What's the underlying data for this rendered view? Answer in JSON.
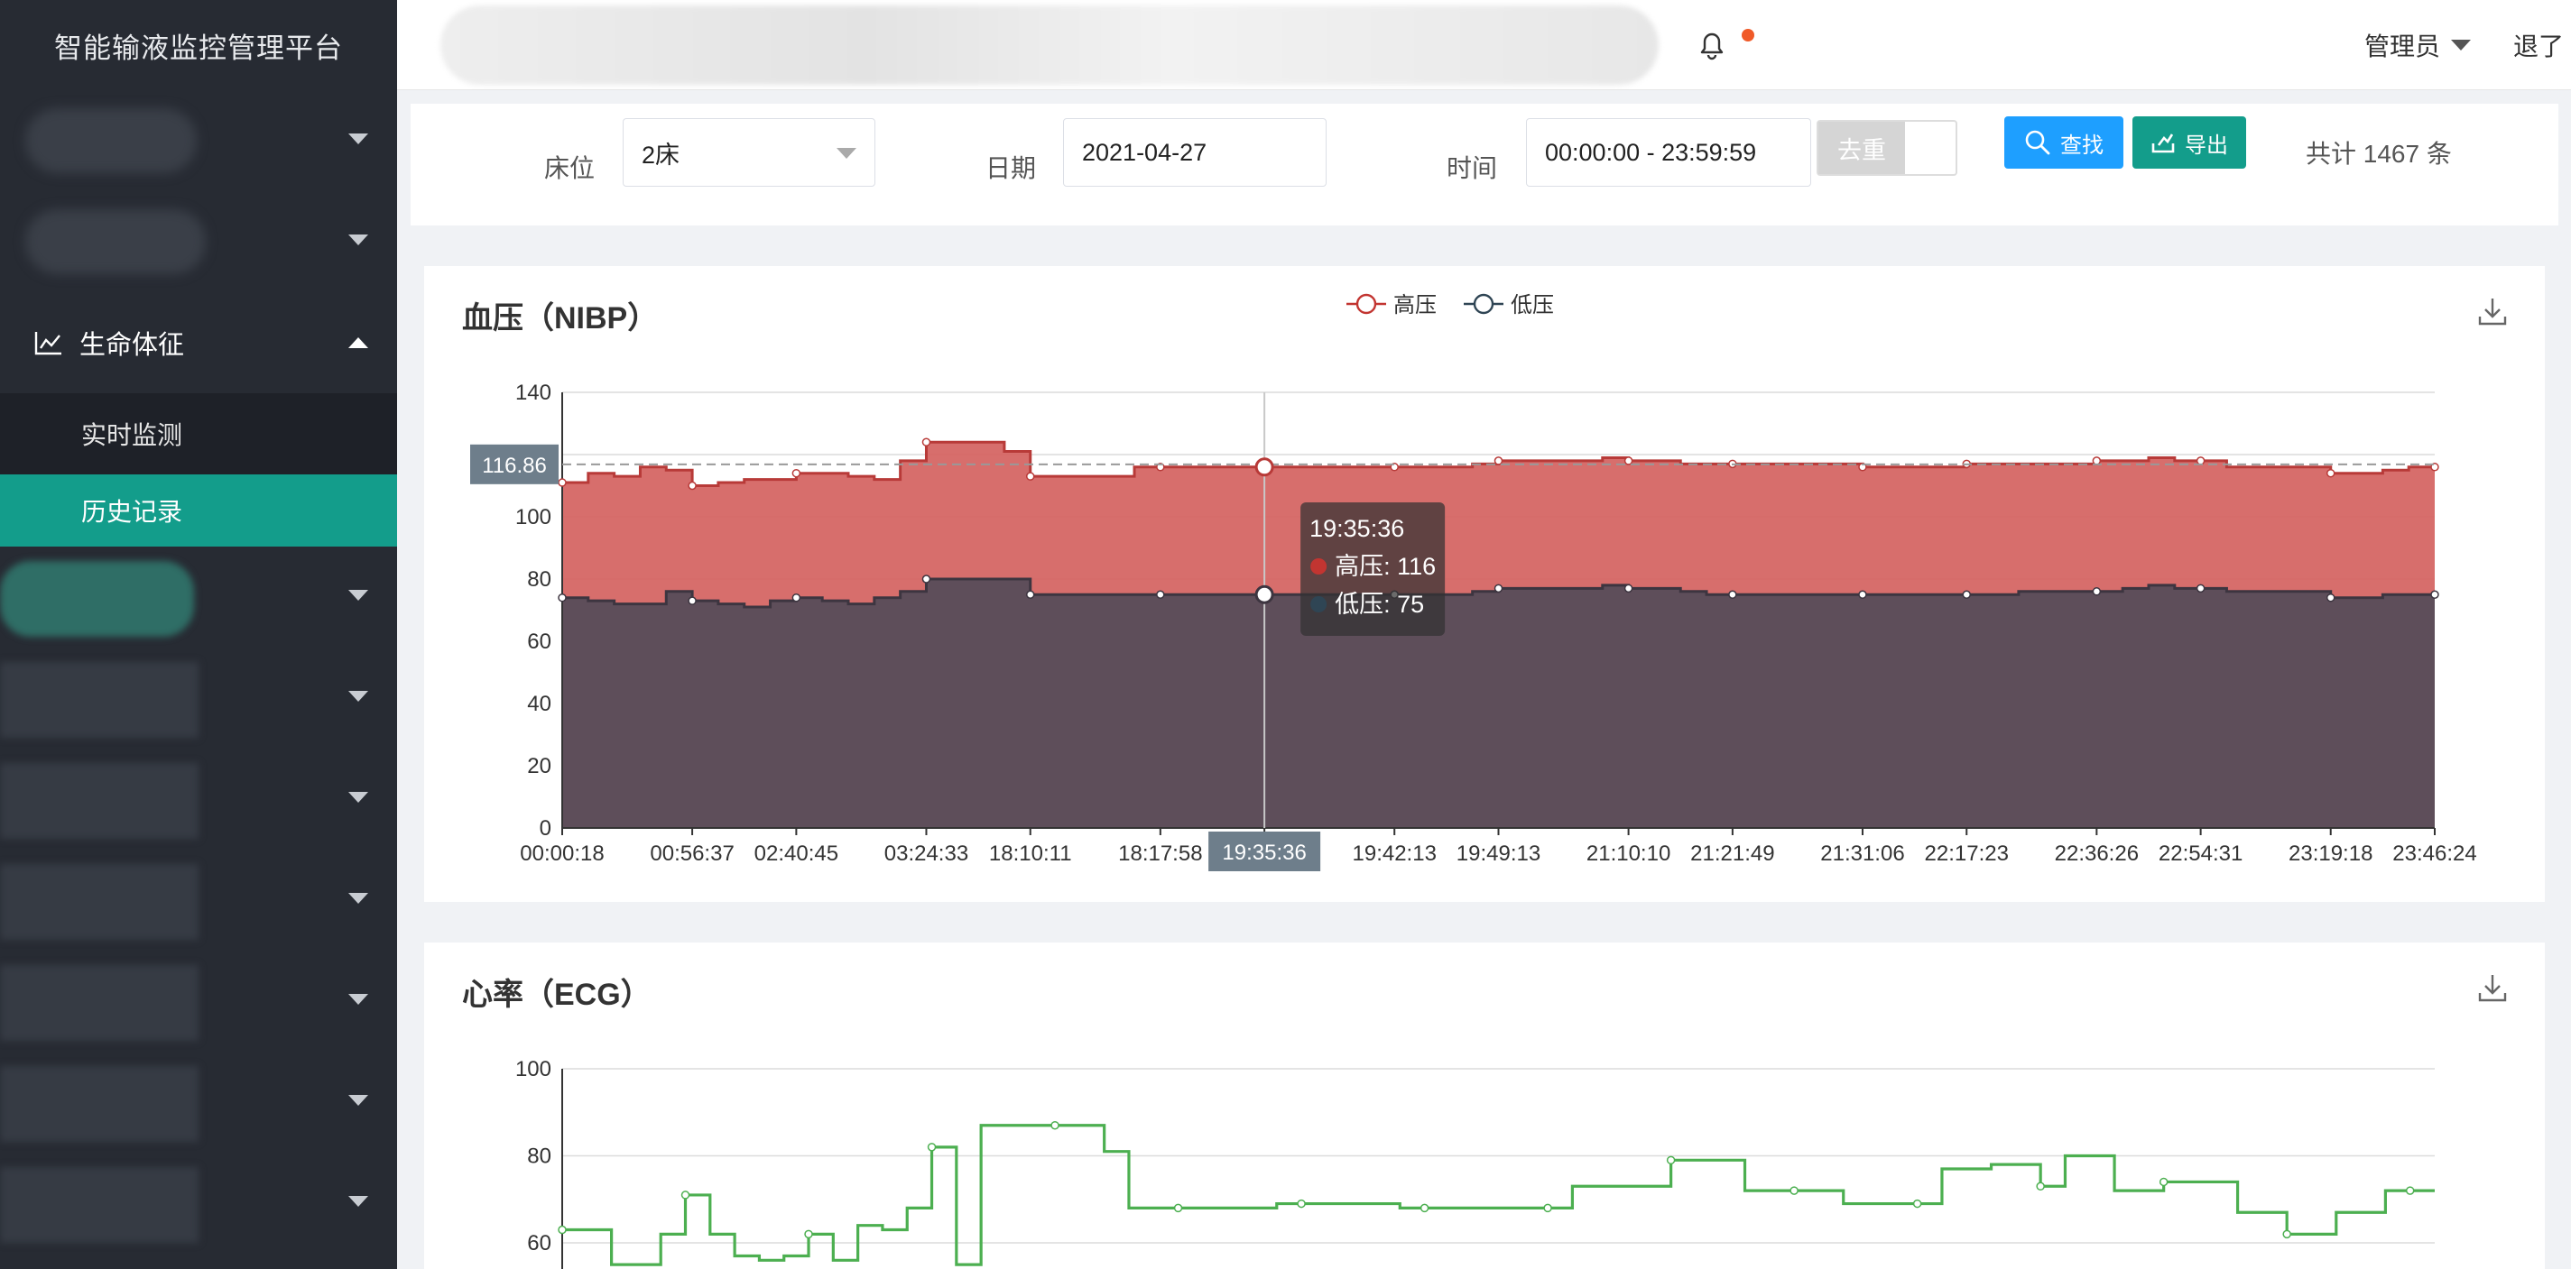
{
  "app": {
    "title": "智能输液监控管理平台"
  },
  "sidebar": {
    "vitals_label": "生命体征",
    "sub_items": [
      {
        "label": "实时监测",
        "active": false
      },
      {
        "label": "历史记录",
        "active": true
      }
    ]
  },
  "header": {
    "user": "管理员",
    "logout": "退了"
  },
  "filters": {
    "bed_label": "床位",
    "bed_value": "2床",
    "date_label": "日期",
    "date_value": "2021-04-27",
    "time_label": "时间",
    "time_value": "00:00:00 - 23:59:59",
    "dedupe_label": "去重",
    "search_label": "查找",
    "export_label": "导出",
    "total_text": "共计 1467 条"
  },
  "colors": {
    "accent": "#139d8b",
    "primary": "#1e9fff",
    "high": "#c23531",
    "low": "#2f4554",
    "ecg": "#4caf50"
  },
  "chart_data": [
    {
      "title": "血压（NIBP）",
      "type": "area",
      "legend": [
        "高压",
        "低压"
      ],
      "legend_position": "top-center",
      "ylim": [
        0,
        140
      ],
      "yticks": [
        0,
        20,
        40,
        60,
        80,
        100,
        120,
        140
      ],
      "xticks": [
        "00:00:18",
        "00:56:37",
        "02:40:45",
        "03:24:33",
        "18:10:11",
        "18:17:58",
        "19:35:36",
        "19:42:13",
        "19:49:13",
        "21:10:10",
        "21:21:49",
        "21:31:06",
        "22:17:23",
        "22:36:26",
        "22:54:31",
        "23:19:18",
        "23:46:24"
      ],
      "x_index": [
        0,
        2,
        4,
        6,
        8,
        10,
        12,
        14,
        16,
        18,
        20,
        22,
        24,
        26,
        28,
        30,
        32
      ],
      "series": [
        {
          "name": "高压",
          "values": [
            111,
            114,
            113,
            116,
            115,
            110,
            111,
            112,
            112,
            114,
            114,
            113,
            112,
            118,
            124,
            124,
            124,
            121,
            113,
            113,
            113,
            113,
            116,
            116,
            116,
            116,
            116,
            116,
            116,
            116,
            116,
            116,
            116,
            116,
            116,
            117,
            118,
            118,
            118,
            118,
            119,
            118,
            118,
            117,
            117,
            117,
            117,
            117,
            117,
            117,
            116,
            116,
            116,
            116,
            117,
            117,
            117,
            117,
            117,
            118,
            118,
            119,
            118,
            118,
            116,
            116,
            116,
            116,
            114,
            114,
            115,
            116,
            116
          ]
        },
        {
          "name": "低压",
          "values": [
            74,
            73,
            72,
            72,
            76,
            73,
            72,
            71,
            73,
            74,
            73,
            72,
            74,
            76,
            80,
            80,
            80,
            80,
            75,
            75,
            75,
            75,
            75,
            75,
            75,
            75,
            75,
            75,
            75,
            75,
            75,
            75,
            75,
            75,
            75,
            76,
            77,
            77,
            77,
            77,
            78,
            77,
            77,
            76,
            75,
            75,
            75,
            75,
            75,
            75,
            75,
            75,
            75,
            75,
            75,
            75,
            76,
            76,
            76,
            76,
            77,
            78,
            77,
            77,
            76,
            76,
            76,
            76,
            74,
            74,
            75,
            75,
            75
          ]
        }
      ],
      "reference_line": {
        "value": 116.86,
        "label": "116.86"
      },
      "tooltip": {
        "time": "19:35:36",
        "items": [
          {
            "name": "高压",
            "value": 116
          },
          {
            "name": "低压",
            "value": 75
          }
        ]
      },
      "axis_pointer_label": "19:35:36"
    },
    {
      "title": "心率（ECG）",
      "type": "line",
      "ylim": [
        60,
        100
      ],
      "yticks": [
        60,
        80,
        100
      ],
      "series": [
        {
          "name": "心率",
          "values": [
            63,
            63,
            55,
            55,
            62,
            71,
            62,
            57,
            56,
            57,
            62,
            56,
            64,
            63,
            68,
            82,
            55,
            87,
            87,
            87,
            87,
            87,
            81,
            68,
            68,
            68,
            68,
            68,
            68,
            69,
            69,
            69,
            69,
            69,
            68,
            68,
            68,
            68,
            68,
            68,
            68,
            73,
            73,
            73,
            73,
            79,
            79,
            79,
            72,
            72,
            72,
            72,
            69,
            69,
            69,
            69,
            77,
            77,
            78,
            78,
            73,
            80,
            80,
            72,
            72,
            74,
            74,
            74,
            67,
            67,
            62,
            62,
            67,
            67,
            72,
            72,
            72
          ]
        }
      ]
    }
  ]
}
